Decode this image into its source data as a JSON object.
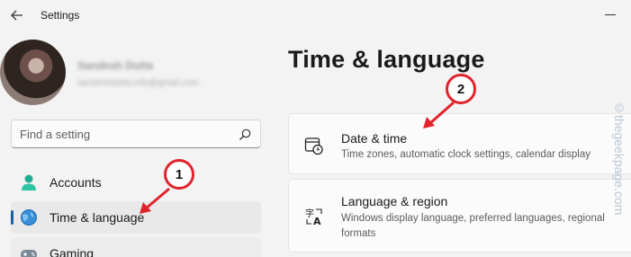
{
  "window": {
    "title": "Settings"
  },
  "profile": {
    "name": "Sandesh Dutta",
    "email": "sandeshdutta.info@gmail.com"
  },
  "search": {
    "placeholder": "Find a setting"
  },
  "sidebar": {
    "items": [
      {
        "label": "Accounts",
        "icon": "accounts-icon",
        "active": false
      },
      {
        "label": "Time & language",
        "icon": "time-language-icon",
        "active": true
      },
      {
        "label": "Gaming",
        "icon": "gaming-icon",
        "active": false
      }
    ]
  },
  "main": {
    "title": "Time & language",
    "cards": [
      {
        "title": "Date & time",
        "description": "Time zones, automatic clock settings, calendar display",
        "icon": "date-time-icon"
      },
      {
        "title": "Language & region",
        "description": "Windows display language, preferred languages, regional formats",
        "icon": "language-region-icon"
      }
    ]
  },
  "watermark": "©thegeekpage.com",
  "annotations": [
    {
      "label": "1"
    },
    {
      "label": "2"
    }
  ],
  "colors": {
    "accent": "#1a5f9e",
    "annotation_red": "#e0242b",
    "background": "#f3f3f3"
  }
}
